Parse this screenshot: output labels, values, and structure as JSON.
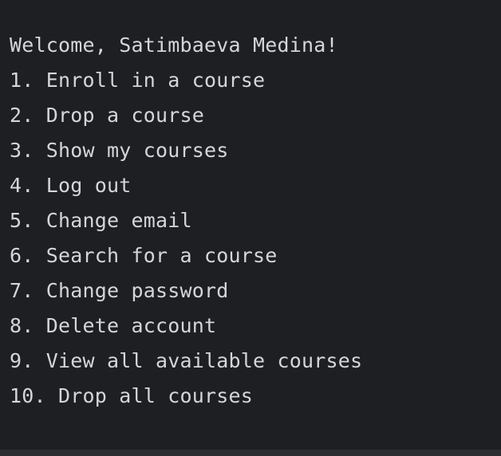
{
  "console": {
    "greeting": "Welcome, Satimbaeva Medina!",
    "menu": [
      "1. Enroll in a course",
      "2. Drop a course",
      "3. Show my courses",
      "4. Log out",
      "5. Change email",
      "6. Search for a course",
      "7. Change password",
      "8. Delete account",
      "9. View all available courses",
      "10. Drop all courses"
    ]
  },
  "colors": {
    "background": "#1e1f22",
    "text": "#d4d6da",
    "bottom_bar": "#2b2d30"
  }
}
